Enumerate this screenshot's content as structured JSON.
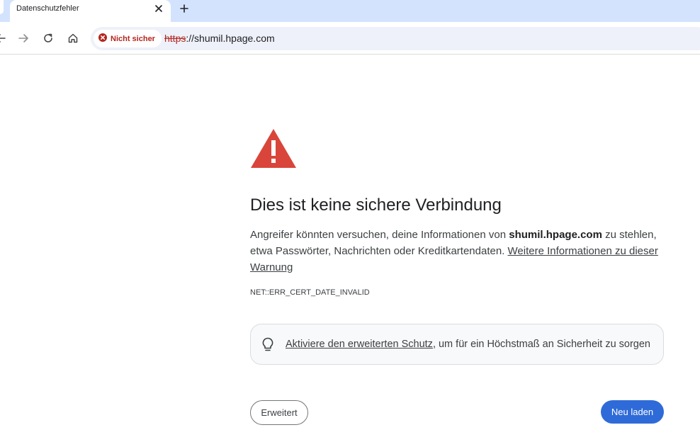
{
  "tab": {
    "title": "Datenschutzfehler",
    "close_icon": "close-icon",
    "new_tab_icon": "plus-icon"
  },
  "toolbar": {
    "security_chip": {
      "label": "Nicht sicher",
      "icon": "error-circle-icon",
      "color": "#b3261e"
    },
    "url": {
      "scheme": "https",
      "rest": "://shumil.hpage.com"
    }
  },
  "page": {
    "heading": "Dies ist keine sichere Verbindung",
    "paragraph": {
      "before": "Angreifer könnten versuchen, deine Informationen von ",
      "domain": "shumil.hpage.com",
      "after": " zu stehlen, etwa Passwörter, Nachrichten oder Kreditkartendaten. ",
      "link": "Weitere Informationen zu dieser Warnung"
    },
    "error_code": "NET::ERR_CERT_DATE_INVALID",
    "promo": {
      "link": "Aktiviere den erweiterten Schutz",
      "rest": ", um für ein Höchstmaß an Sicherheit zu sorgen"
    },
    "buttons": {
      "advanced": "Erweitert",
      "reload": "Neu laden"
    }
  },
  "colors": {
    "tabstrip": "#d3e3fd",
    "warning_red": "#d9453b",
    "primary_button": "#2f6bd8"
  }
}
